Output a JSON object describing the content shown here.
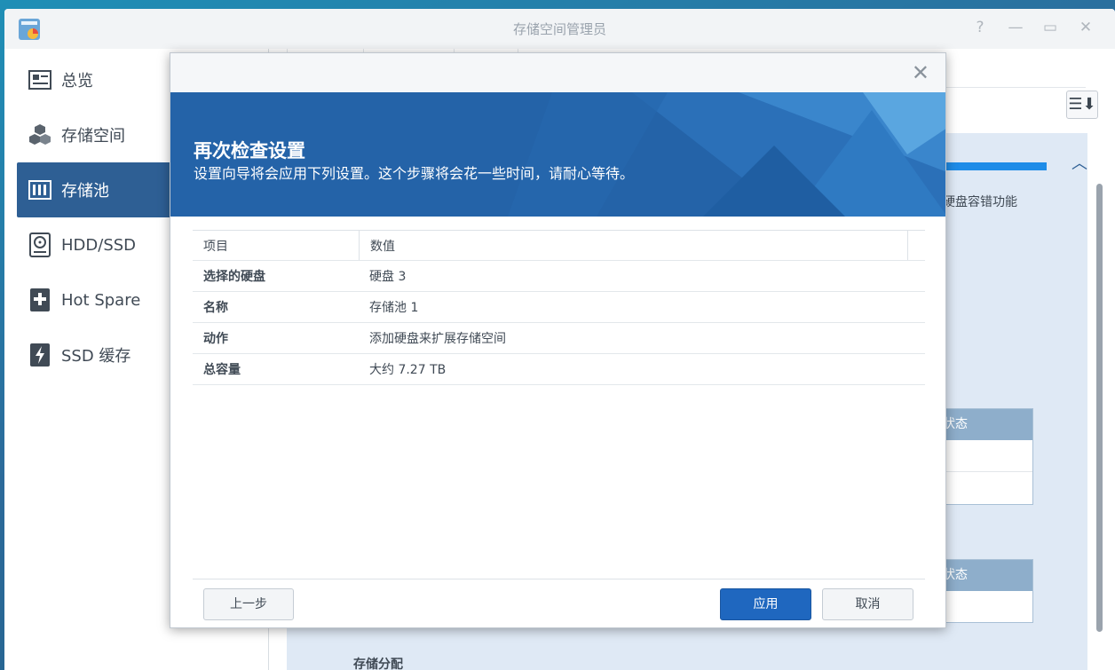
{
  "window": {
    "title": "存储空间管理员",
    "controls": {
      "help": "?",
      "minimize": "—",
      "maximize": "▭",
      "close": "✕"
    }
  },
  "sidebar": {
    "items": [
      {
        "label": "总览",
        "icon": "overview-icon",
        "active": false
      },
      {
        "label": "存储空间",
        "icon": "volume-cubes-icon",
        "active": false
      },
      {
        "label": "存储池",
        "icon": "storage-pool-icon",
        "active": true
      },
      {
        "label": "HDD/SSD",
        "icon": "hdd-icon",
        "active": false
      },
      {
        "label": "Hot Spare",
        "icon": "hot-spare-icon",
        "active": false
      },
      {
        "label": "SSD 缓存",
        "icon": "ssd-cache-icon",
        "active": false
      }
    ]
  },
  "background": {
    "fragment_text": "硬盘容错功能",
    "status_header_1": "状态",
    "status_header_2": "状态",
    "storage_allocation": "存储分配"
  },
  "dialog": {
    "heading": "再次检查设置",
    "subheading": "设置向导将会应用下列设置。这个步骤将会花一些时间，请耐心等待。",
    "table": {
      "headers": [
        "项目",
        "数值"
      ],
      "rows": [
        {
          "item": "选择的硬盘",
          "value": "硬盘 3"
        },
        {
          "item": "名称",
          "value": "存储池 1"
        },
        {
          "item": "动作",
          "value": "添加硬盘来扩展存储空间"
        },
        {
          "item": "总容量",
          "value": "大约 7.27 TB"
        }
      ]
    },
    "buttons": {
      "back": "上一步",
      "apply": "应用",
      "cancel": "取消"
    }
  },
  "colors": {
    "accent": "#1f67bf",
    "sidebar_active": "#2e5f94",
    "banner": "#2463a8"
  }
}
